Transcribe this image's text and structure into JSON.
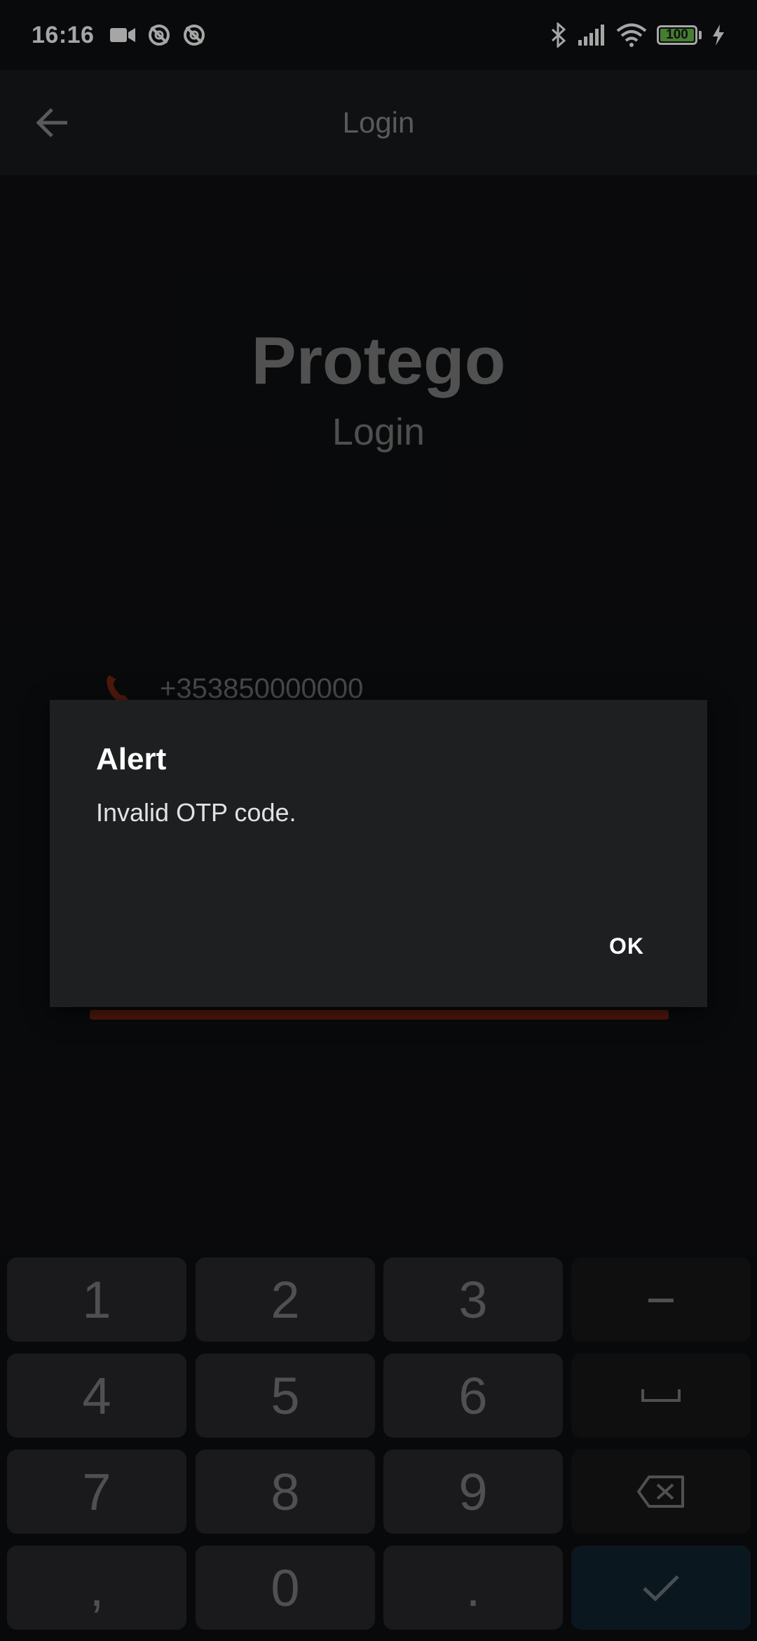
{
  "status_bar": {
    "time": "16:16",
    "battery_level": "100",
    "icons": [
      "video-camera-icon",
      "sync-off-icon",
      "sync-off-icon",
      "bluetooth-icon",
      "signal-icon",
      "wifi-icon",
      "battery-icon",
      "charging-bolt-icon"
    ]
  },
  "app_bar": {
    "title": "Login",
    "back_icon": "arrow-left-icon"
  },
  "screen": {
    "brand_title": "Protego",
    "brand_subtitle": "Login",
    "phone_icon": "phone-icon",
    "phone_value": "+353850000000"
  },
  "dialog": {
    "title": "Alert",
    "message": "Invalid OTP code.",
    "ok_label": "OK"
  },
  "keypad": {
    "keys": [
      "1",
      "2",
      "3",
      "−",
      "4",
      "5",
      "6",
      "␣",
      "7",
      "8",
      "9",
      "⌫",
      ",",
      "0",
      ".",
      "✓"
    ],
    "colors": {
      "key": "#28292c",
      "fn_key": "#17181a",
      "done_key": "#102430"
    }
  },
  "colors": {
    "background": "#0f1012",
    "app_bar": "#1a1b1e",
    "dialog": "#1e1f21",
    "accent_red": "#7a2514",
    "battery_green": "#6cc24a"
  }
}
